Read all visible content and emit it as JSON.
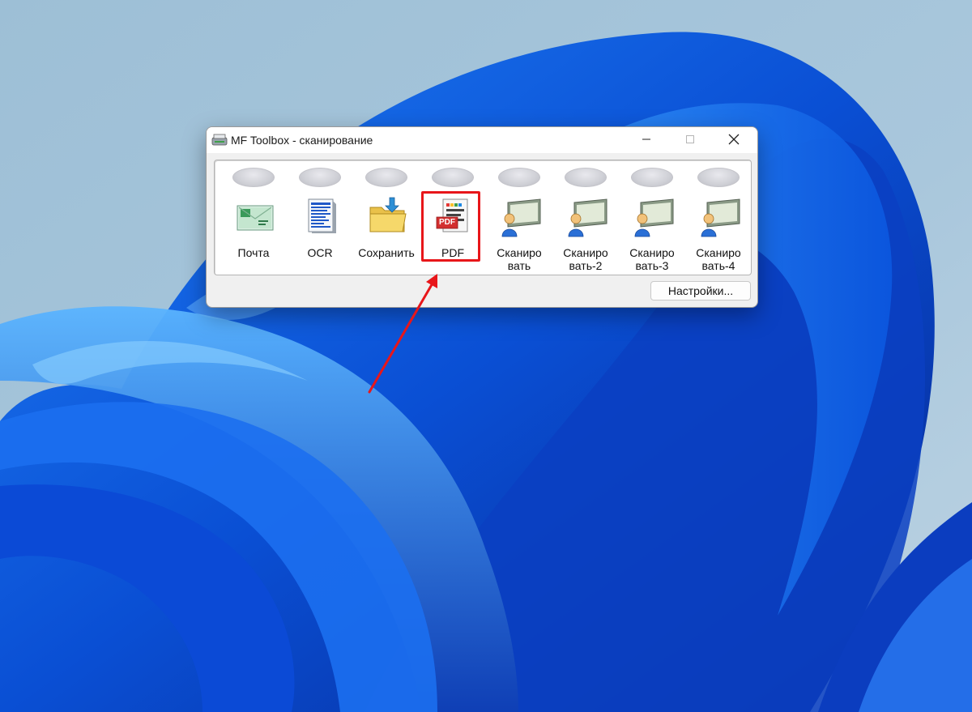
{
  "window": {
    "title": "MF Toolbox - сканирование",
    "minimize_icon": "minimize-icon",
    "maximize_icon": "maximize-icon",
    "close_icon": "close-icon"
  },
  "tiles": [
    {
      "label": "Почта",
      "icon": "mail-icon"
    },
    {
      "label": "OCR",
      "icon": "ocr-document-icon"
    },
    {
      "label": "Сохранить",
      "icon": "folder-save-icon"
    },
    {
      "label": "PDF",
      "icon": "pdf-icon"
    },
    {
      "label": "Сканиро\nвать",
      "icon": "scan-user-icon"
    },
    {
      "label": "Сканиро\nвать-2",
      "icon": "scan-user-icon"
    },
    {
      "label": "Сканиро\nвать-3",
      "icon": "scan-user-icon"
    },
    {
      "label": "Сканиро\nвать-4",
      "icon": "scan-user-icon"
    }
  ],
  "pdf_badge": "PDF",
  "settings_button": "Настройки...",
  "annotation": {
    "color": "#e8161a",
    "target": "PDF"
  }
}
